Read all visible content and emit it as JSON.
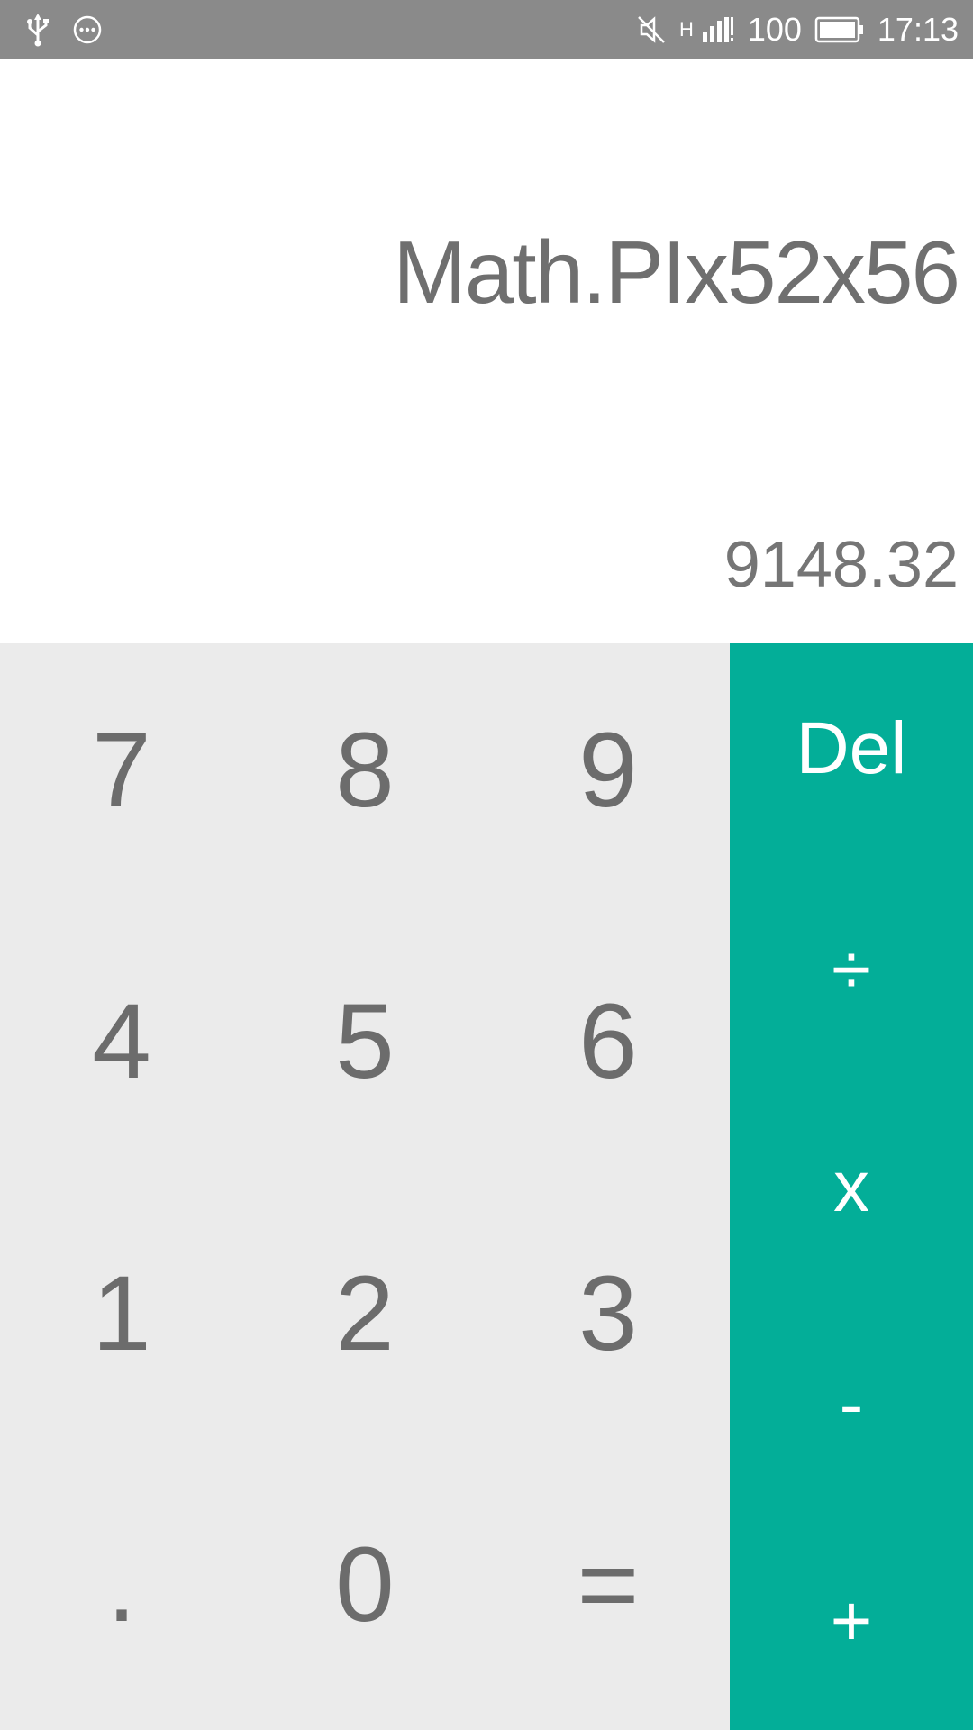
{
  "status_bar": {
    "icons": [
      "usb-icon",
      "more-icon",
      "mute-icon",
      "signal-icon",
      "battery-icon"
    ],
    "network_type": "H",
    "battery_level": "100",
    "time": "17:13"
  },
  "display": {
    "expression": "Math.PIx52x56",
    "result": "9148.32"
  },
  "keypad": {
    "rows": [
      [
        "7",
        "8",
        "9"
      ],
      [
        "4",
        "5",
        "6"
      ],
      [
        "1",
        "2",
        "3"
      ],
      [
        ".",
        "0",
        "="
      ]
    ]
  },
  "operators": {
    "del": "Del",
    "divide": "÷",
    "multiply": "x",
    "subtract": "-",
    "add": "+"
  },
  "colors": {
    "status_bar": "#8a8a8a",
    "display_bg": "#ffffff",
    "keypad_bg": "#ebebeb",
    "operator_bg": "#03ae98",
    "digit_text": "#6c6c6c",
    "operator_text": "#ffffff"
  }
}
